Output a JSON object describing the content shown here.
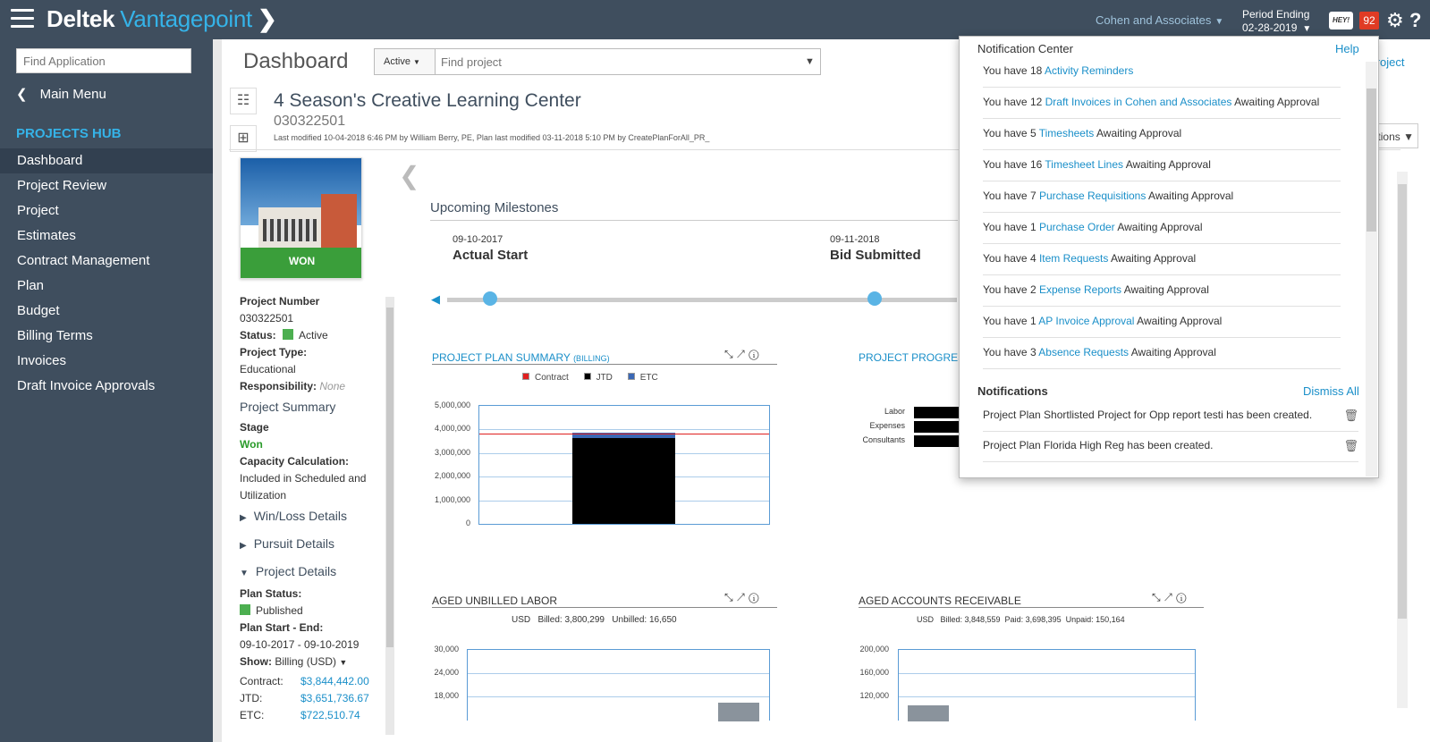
{
  "header": {
    "brand": "Deltek",
    "brand_product": "Vantagepoint",
    "company": "Cohen and Associates",
    "period_label": "Period Ending",
    "period_value": "02-28-2019",
    "hey_label": "HEY!",
    "badge_count": "92",
    "accent_color": "#35b3e8",
    "bar_color": "#3f4e5e",
    "icons": [
      "hamburger-icon",
      "chevron-right-icon",
      "gear-icon",
      "help-icon"
    ]
  },
  "sidebar": {
    "search_placeholder": "Find Application",
    "main_menu": "Main Menu",
    "hub_title": "PROJECTS HUB",
    "items": [
      {
        "label": "Dashboard"
      },
      {
        "label": "Project Review"
      },
      {
        "label": "Project"
      },
      {
        "label": "Estimates"
      },
      {
        "label": "Contract Management"
      },
      {
        "label": "Plan"
      },
      {
        "label": "Budget"
      },
      {
        "label": "Billing Terms"
      },
      {
        "label": "Invoices"
      },
      {
        "label": "Draft Invoice Approvals"
      }
    ]
  },
  "page": {
    "title": "Dashboard",
    "active_filter": "Active",
    "find_project_placeholder": "Find project",
    "project_link": "Project",
    "options_label": "tions"
  },
  "project": {
    "title": "4 Season's Creative Learning Center",
    "number": "030322501",
    "modified": "Last modified 10-04-2018 6:46 PM by William Berry, PE, Plan last modified 03-11-2018 5:10 PM by CreatePlanForAll_PR_",
    "image_label": "WON",
    "info": {
      "project_number_label": "Project Number",
      "project_number": "030322501",
      "status_label": "Status:",
      "status": "Active",
      "type_label": "Project Type:",
      "type": "Educational",
      "responsibility_label": "Responsibility:",
      "responsibility": "None",
      "summary_heading": "Project Summary",
      "stage_label": "Stage",
      "stage": "Won",
      "capacity_label": "Capacity Calculation:",
      "capacity": "Included in Scheduled and Utilization",
      "winloss": "Win/Loss Details",
      "pursuit": "Pursuit Details",
      "details": "Project Details",
      "plan_status_label": "Plan Status:",
      "plan_status": "Published",
      "plan_dates_label": "Plan Start - End:",
      "plan_dates": "09-10-2017 - 09-10-2019",
      "show_label": "Show:",
      "show_value": "Billing (USD)",
      "contract_label": "Contract:",
      "contract": "$3,844,442.00",
      "jtd_label": "JTD:",
      "jtd": "$3,651,736.67",
      "etc_label": "ETC:",
      "etc": "$722,510.74"
    }
  },
  "milestones": {
    "title": "Upcoming Milestones",
    "items": [
      {
        "date": "09-10-2017",
        "name": "Actual Start"
      },
      {
        "date": "09-11-2018",
        "name": "Bid Submitted"
      }
    ]
  },
  "widgets": {
    "plan_summary": {
      "title": "PROJECT PLAN SUMMARY",
      "subtitle": "(BILLING)",
      "legend": [
        "Contract",
        "JTD",
        "ETC"
      ],
      "colors": {
        "Contract": "#e02020",
        "JTD": "#000000",
        "ETC": "#3b68b5"
      },
      "yticks": [
        "5,000,000",
        "4,000,000",
        "3,000,000",
        "2,000,000",
        "1,000,000",
        "0"
      ]
    },
    "progress": {
      "title": "PROJECT PROGRES",
      "rows": [
        "Labor",
        "Expenses",
        "Consultants"
      ]
    },
    "aged_unbilled": {
      "title": "AGED UNBILLED LABOR",
      "info": "USD   Billed: 3,800,299   Unbilled: 16,650",
      "yticks": [
        "30,000",
        "24,000",
        "18,000"
      ]
    },
    "aged_ar": {
      "title": "AGED ACCOUNTS RECEIVABLE",
      "info": "USD   Billed: 3,848,559  Paid: 3,698,395  Unpaid: 150,164",
      "yticks": [
        "200,000",
        "160,000",
        "120,000"
      ]
    }
  },
  "chart_data": [
    {
      "type": "bar",
      "title": "PROJECT PLAN SUMMARY (BILLING)",
      "ylim": [
        0,
        5000000
      ],
      "series": [
        {
          "name": "JTD",
          "values": [
            3651736.67
          ]
        },
        {
          "name": "ETC",
          "values": [
            722510.74
          ]
        }
      ],
      "reference_line": {
        "name": "Contract",
        "value": 3844442.0
      }
    },
    {
      "type": "bar",
      "title": "AGED UNBILLED LABOR",
      "ylim": [
        0,
        30000
      ],
      "values": [
        16650
      ]
    },
    {
      "type": "bar",
      "title": "AGED ACCOUNTS RECEIVABLE",
      "ylim": [
        0,
        200000
      ],
      "values": [
        150164
      ]
    }
  ],
  "notifications": {
    "title": "Notification Center",
    "help": "Help",
    "reminders": [
      {
        "pre": "You have 18 ",
        "link": "Activity Reminders",
        "post": ""
      },
      {
        "pre": "You have 12 ",
        "link": "Draft Invoices in Cohen and Associates",
        "post": " Awaiting Approval"
      },
      {
        "pre": "You have 5 ",
        "link": "Timesheets",
        "post": " Awaiting Approval"
      },
      {
        "pre": "You have 16 ",
        "link": "Timesheet Lines",
        "post": " Awaiting Approval"
      },
      {
        "pre": "You have 7 ",
        "link": "Purchase Requisitions",
        "post": " Awaiting Approval"
      },
      {
        "pre": "You have 1 ",
        "link": "Purchase Order",
        "post": " Awaiting Approval"
      },
      {
        "pre": "You have 4 ",
        "link": "Item Requests",
        "post": " Awaiting Approval"
      },
      {
        "pre": "You have 2 ",
        "link": "Expense Reports",
        "post": " Awaiting Approval"
      },
      {
        "pre": "You have 1 ",
        "link": "AP Invoice Approval",
        "post": " Awaiting Approval"
      },
      {
        "pre": "You have 3 ",
        "link": "Absence Requests",
        "post": " Awaiting Approval"
      }
    ],
    "section_title": "Notifications",
    "dismiss_all": "Dismiss All",
    "items": [
      {
        "text": "Project Plan Shortlisted Project for Opp report testi has been created."
      },
      {
        "text": "Project Plan Florida High Reg has been created."
      }
    ]
  }
}
